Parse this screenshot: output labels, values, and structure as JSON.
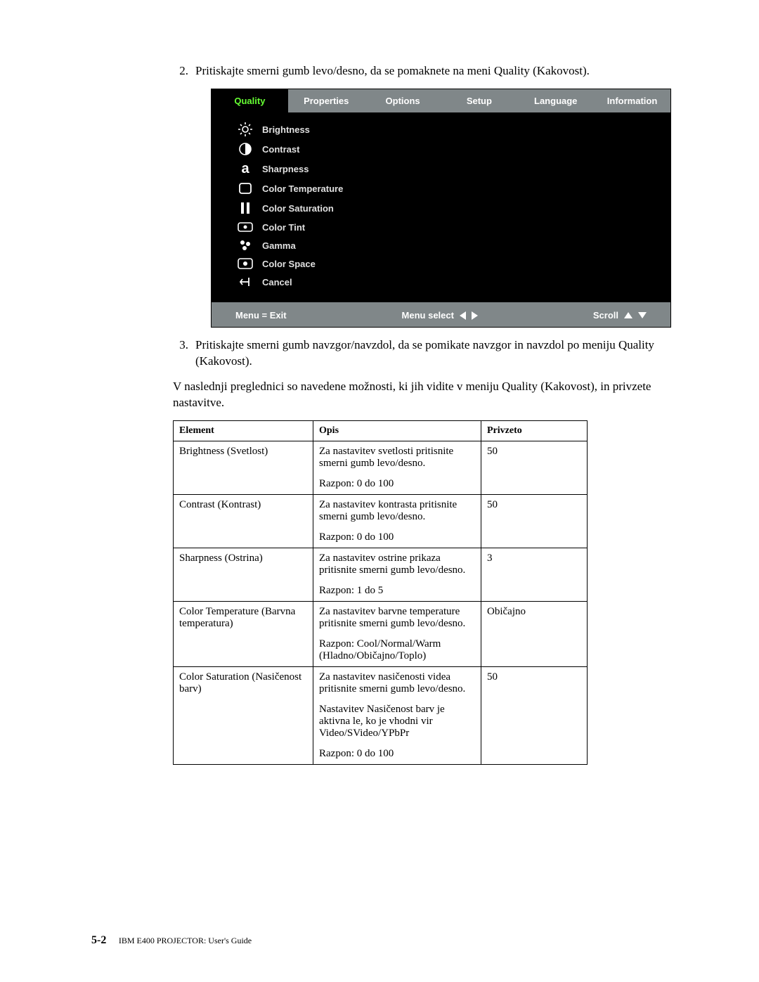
{
  "steps": {
    "s2_num": "2.",
    "s2_txt": "Pritiskajte smerni gumb levo/desno, da se pomaknete na meni Quality (Kakovost).",
    "s3_num": "3.",
    "s3_txt": "Pritiskajte smerni gumb navzgor/navzdol, da se pomikate navzgor in navzdol po meniju Quality (Kakovost)."
  },
  "para": "V naslednji preglednici so navedene možnosti, ki jih vidite v meniju Quality (Kakovost), in privzete nastavitve.",
  "osd": {
    "tabs": [
      "Quality",
      "Properties",
      "Options",
      "Setup",
      "Language",
      "Information"
    ],
    "items": [
      "Brightness",
      "Contrast",
      "Sharpness",
      "Color Temperature",
      "Color Saturation",
      "Color Tint",
      "Gamma",
      "Color Space",
      "Cancel"
    ],
    "footer_menu": "Menu = Exit",
    "footer_select": "Menu select",
    "footer_scroll": "Scroll"
  },
  "table": {
    "h1": "Element",
    "h2": "Opis",
    "h3": "Privzeto",
    "rows": [
      {
        "el": "Brightness (Svetlost)",
        "op": [
          "Za nastavitev svetlosti pritisnite smerni gumb levo/desno.",
          "Razpon: 0 do 100"
        ],
        "pr": "50"
      },
      {
        "el": "Contrast (Kontrast)",
        "op": [
          "Za nastavitev kontrasta pritisnite smerni gumb levo/desno.",
          "Razpon: 0 do 100"
        ],
        "pr": "50"
      },
      {
        "el": "Sharpness (Ostrina)",
        "op": [
          "Za nastavitev ostrine prikaza pritisnite smerni gumb levo/desno.",
          "Razpon: 1 do 5"
        ],
        "pr": "3"
      },
      {
        "el": "Color Temperature (Barvna temperatura)",
        "op": [
          "Za nastavitev barvne temperature pritisnite smerni gumb levo/desno.",
          "Razpon: Cool/Normal/Warm (Hladno/Običajno/Toplo)"
        ],
        "pr": "Običajno"
      },
      {
        "el": "Color Saturation (Nasičenost barv)",
        "op": [
          "Za nastavitev nasičenosti videa pritisnite smerni gumb levo/desno.",
          "Nastavitev Nasičenost barv je aktivna le, ko je vhodni vir Video/SVideo/YPbPr",
          "Razpon: 0 do 100"
        ],
        "pr": "50"
      }
    ]
  },
  "footer": {
    "page": "5-2",
    "title": "IBM E400 PROJECTOR: User's Guide"
  }
}
